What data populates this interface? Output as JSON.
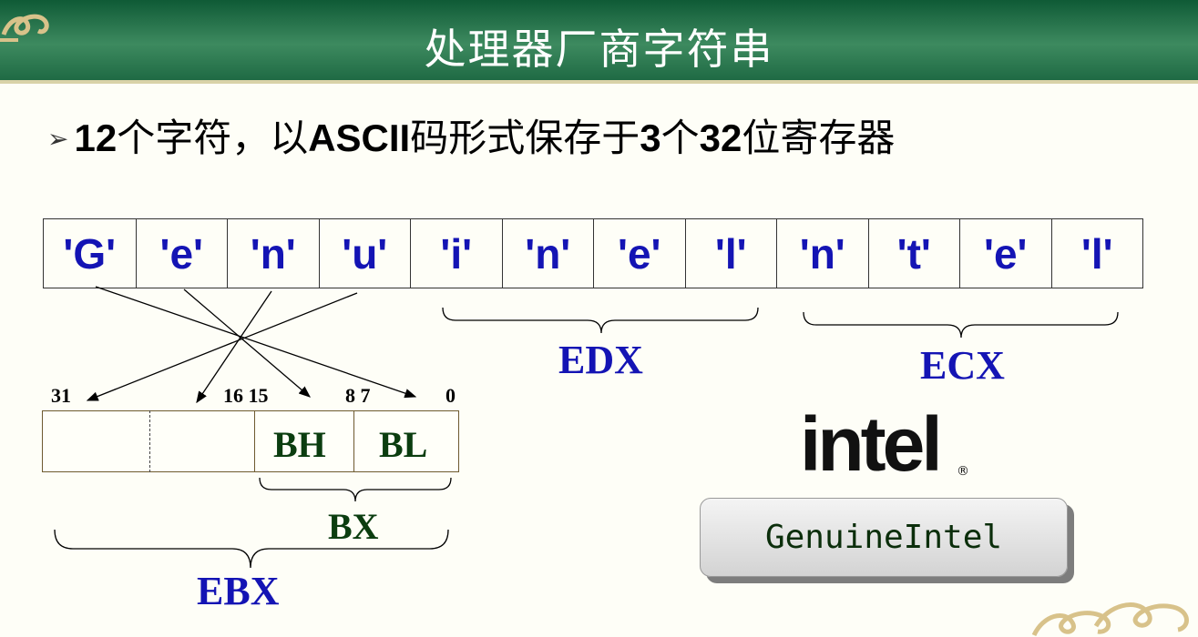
{
  "slide": {
    "title": "处理器厂商字符串"
  },
  "bullet": {
    "part1": "12",
    "part2": "个字符，以",
    "part3": "ASCII",
    "part4": "码形式保存于",
    "part5": "3",
    "part6": "个",
    "part7": "32",
    "part8": "位寄存器"
  },
  "chars": [
    "'G'",
    "'e'",
    "'n'",
    "'u'",
    "'i'",
    "'n'",
    "'e'",
    "'l'",
    "'n'",
    "'t'",
    "'e'",
    "'l'"
  ],
  "registers": {
    "edx": "EDX",
    "ecx": "ECX",
    "ebx": "EBX",
    "bx": "BX",
    "bh": "BH",
    "bl": "BL"
  },
  "bits": {
    "b31": "31",
    "b16_15": "16 15",
    "b8_7": "8 7",
    "b0": "0"
  },
  "logo": {
    "text": "intel",
    "mark": "®"
  },
  "vendor_string": "GenuineIntel",
  "colors": {
    "title_bar": "#1f6a44",
    "char_text": "#1414b4",
    "register_label": "#1414b4",
    "subregister_label": "#0b3d10"
  }
}
